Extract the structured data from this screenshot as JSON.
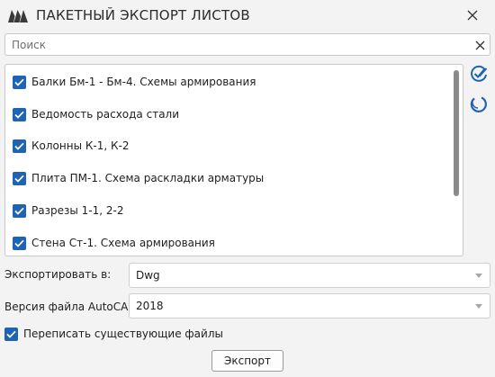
{
  "window": {
    "title": "ПАКЕТНЫЙ ЭКСПОРТ ЛИСТОВ",
    "logo_icon": "logo-icon",
    "close_icon": "close-icon"
  },
  "search": {
    "placeholder": "Поиск",
    "value": ""
  },
  "sheets": {
    "items": [
      {
        "label": "Балки Бм-1 - Бм-4. Схемы армирования",
        "checked": true
      },
      {
        "label": "Ведомость расхода стали",
        "checked": true
      },
      {
        "label": "Колонны К-1, К-2",
        "checked": true
      },
      {
        "label": "Плита ПМ-1. Схема раскладки арматуры",
        "checked": true
      },
      {
        "label": "Разрезы 1-1, 2-2",
        "checked": true
      },
      {
        "label": "Стена Ст-1. Схема армирования",
        "checked": true
      }
    ]
  },
  "side_actions": {
    "select_all_icon": "check-all-icon",
    "refresh_icon": "refresh-icon"
  },
  "export_to": {
    "label": "Экспортировать в:",
    "value": "Dwg"
  },
  "autocad_version": {
    "label": "Версия файла AutoCAD:",
    "value": "2018"
  },
  "overwrite": {
    "label": "Переписать существующие файлы",
    "checked": true
  },
  "export_button": {
    "label": "Экспорт"
  },
  "colors": {
    "accent": "#1f63b5",
    "background": "#f3f3f3"
  }
}
